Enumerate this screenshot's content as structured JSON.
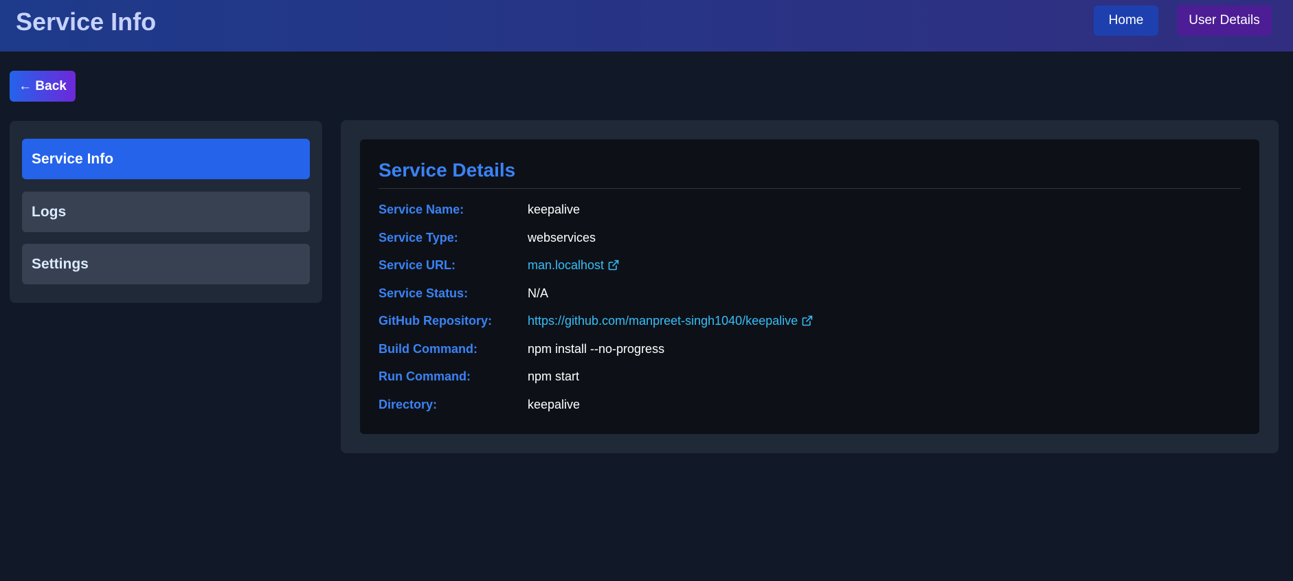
{
  "header": {
    "title": "Service Info",
    "nav": {
      "home_label": "Home",
      "user_details_label": "User Details"
    }
  },
  "back_label": "← Back",
  "sidebar": {
    "items": [
      {
        "label": "Service Info",
        "active": true
      },
      {
        "label": "Logs",
        "active": false
      },
      {
        "label": "Settings",
        "active": false
      }
    ]
  },
  "details": {
    "title": "Service Details",
    "rows": [
      {
        "label": "Service Name:",
        "value": "keepalive"
      },
      {
        "label": "Service Type:",
        "value": "webservices"
      },
      {
        "label": "Service URL:",
        "value": "man.localhost",
        "link": true,
        "icon": "external-link-icon"
      },
      {
        "label": "Service Status:",
        "value": "N/A"
      },
      {
        "label": "GitHub Repository:",
        "value": "https://github.com/manpreet-singh1040/keepalive",
        "link": true,
        "icon": "external-link-icon"
      },
      {
        "label": "Build Command:",
        "value": "npm install --no-progress"
      },
      {
        "label": "Run Command:",
        "value": "npm start"
      },
      {
        "label": "Directory:",
        "value": "keepalive"
      }
    ]
  },
  "colors": {
    "accent": "#3b82f6",
    "active_tab": "#2563eb",
    "link": "#38bdf8",
    "background": "#111827"
  }
}
